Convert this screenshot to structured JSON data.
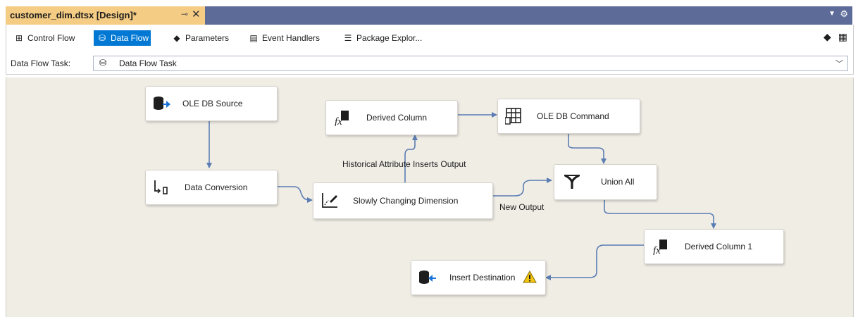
{
  "document_tab": {
    "title": "customer_dim.dtsx [Design]*",
    "pin": "⊸",
    "close": "✕"
  },
  "designer_tabs": [
    {
      "label": "Control Flow",
      "icon": "control-flow-icon",
      "active": false
    },
    {
      "label": "Data Flow",
      "icon": "data-flow-icon",
      "active": true
    },
    {
      "label": "Parameters",
      "icon": "parameters-icon",
      "active": false
    },
    {
      "label": "Event Handlers",
      "icon": "event-handlers-icon",
      "active": false
    },
    {
      "label": "Package Explor...",
      "icon": "package-explorer-icon",
      "active": false
    }
  ],
  "task": {
    "label": "Data Flow Task:",
    "value": "Data Flow Task"
  },
  "nodes": {
    "ole_db_source": "OLE DB Source",
    "data_conversion": "Data Conversion",
    "derived_column": "Derived Column",
    "ole_db_command": "OLE DB Command",
    "slowly_changing_dimension": "Slowly Changing Dimension",
    "union_all": "Union All",
    "derived_column_1": "Derived Column 1",
    "insert_destination": "Insert Destination"
  },
  "flow_labels": {
    "historical": "Historical Attribute Inserts Output",
    "new_output": "New Output"
  },
  "colors": {
    "tab_active": "#0078d4",
    "doc_tab": "#f5cc84",
    "tab_strip": "#5d6b99",
    "canvas": "#f0ede5",
    "connector": "#5b7db3"
  }
}
